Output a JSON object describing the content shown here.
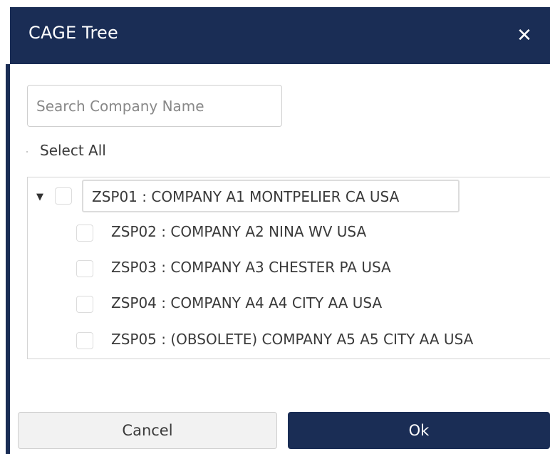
{
  "dialog": {
    "title": "CAGE Tree",
    "close_glyph": "✕"
  },
  "search": {
    "placeholder": "Search Company Name",
    "value": ""
  },
  "select_all_label": "Select All",
  "tree": {
    "root": {
      "label": "ZSP01 : COMPANY A1 MONTPELIER CA USA",
      "expanded": true,
      "checked": false
    },
    "children": [
      {
        "label": "ZSP02 : COMPANY A2 NINA WV USA",
        "checked": false
      },
      {
        "label": "ZSP03 : COMPANY A3 CHESTER PA USA",
        "checked": false
      },
      {
        "label": "ZSP04 : COMPANY A4 A4 CITY AA USA",
        "checked": false
      },
      {
        "label": "ZSP05 : (OBSOLETE) COMPANY A5 A5 CITY AA USA",
        "checked": false
      }
    ]
  },
  "buttons": {
    "cancel_label": "Cancel",
    "ok_label": "Ok"
  },
  "colors": {
    "header_bg": "#1a2d55",
    "primary_button_bg": "#1a2d55"
  }
}
